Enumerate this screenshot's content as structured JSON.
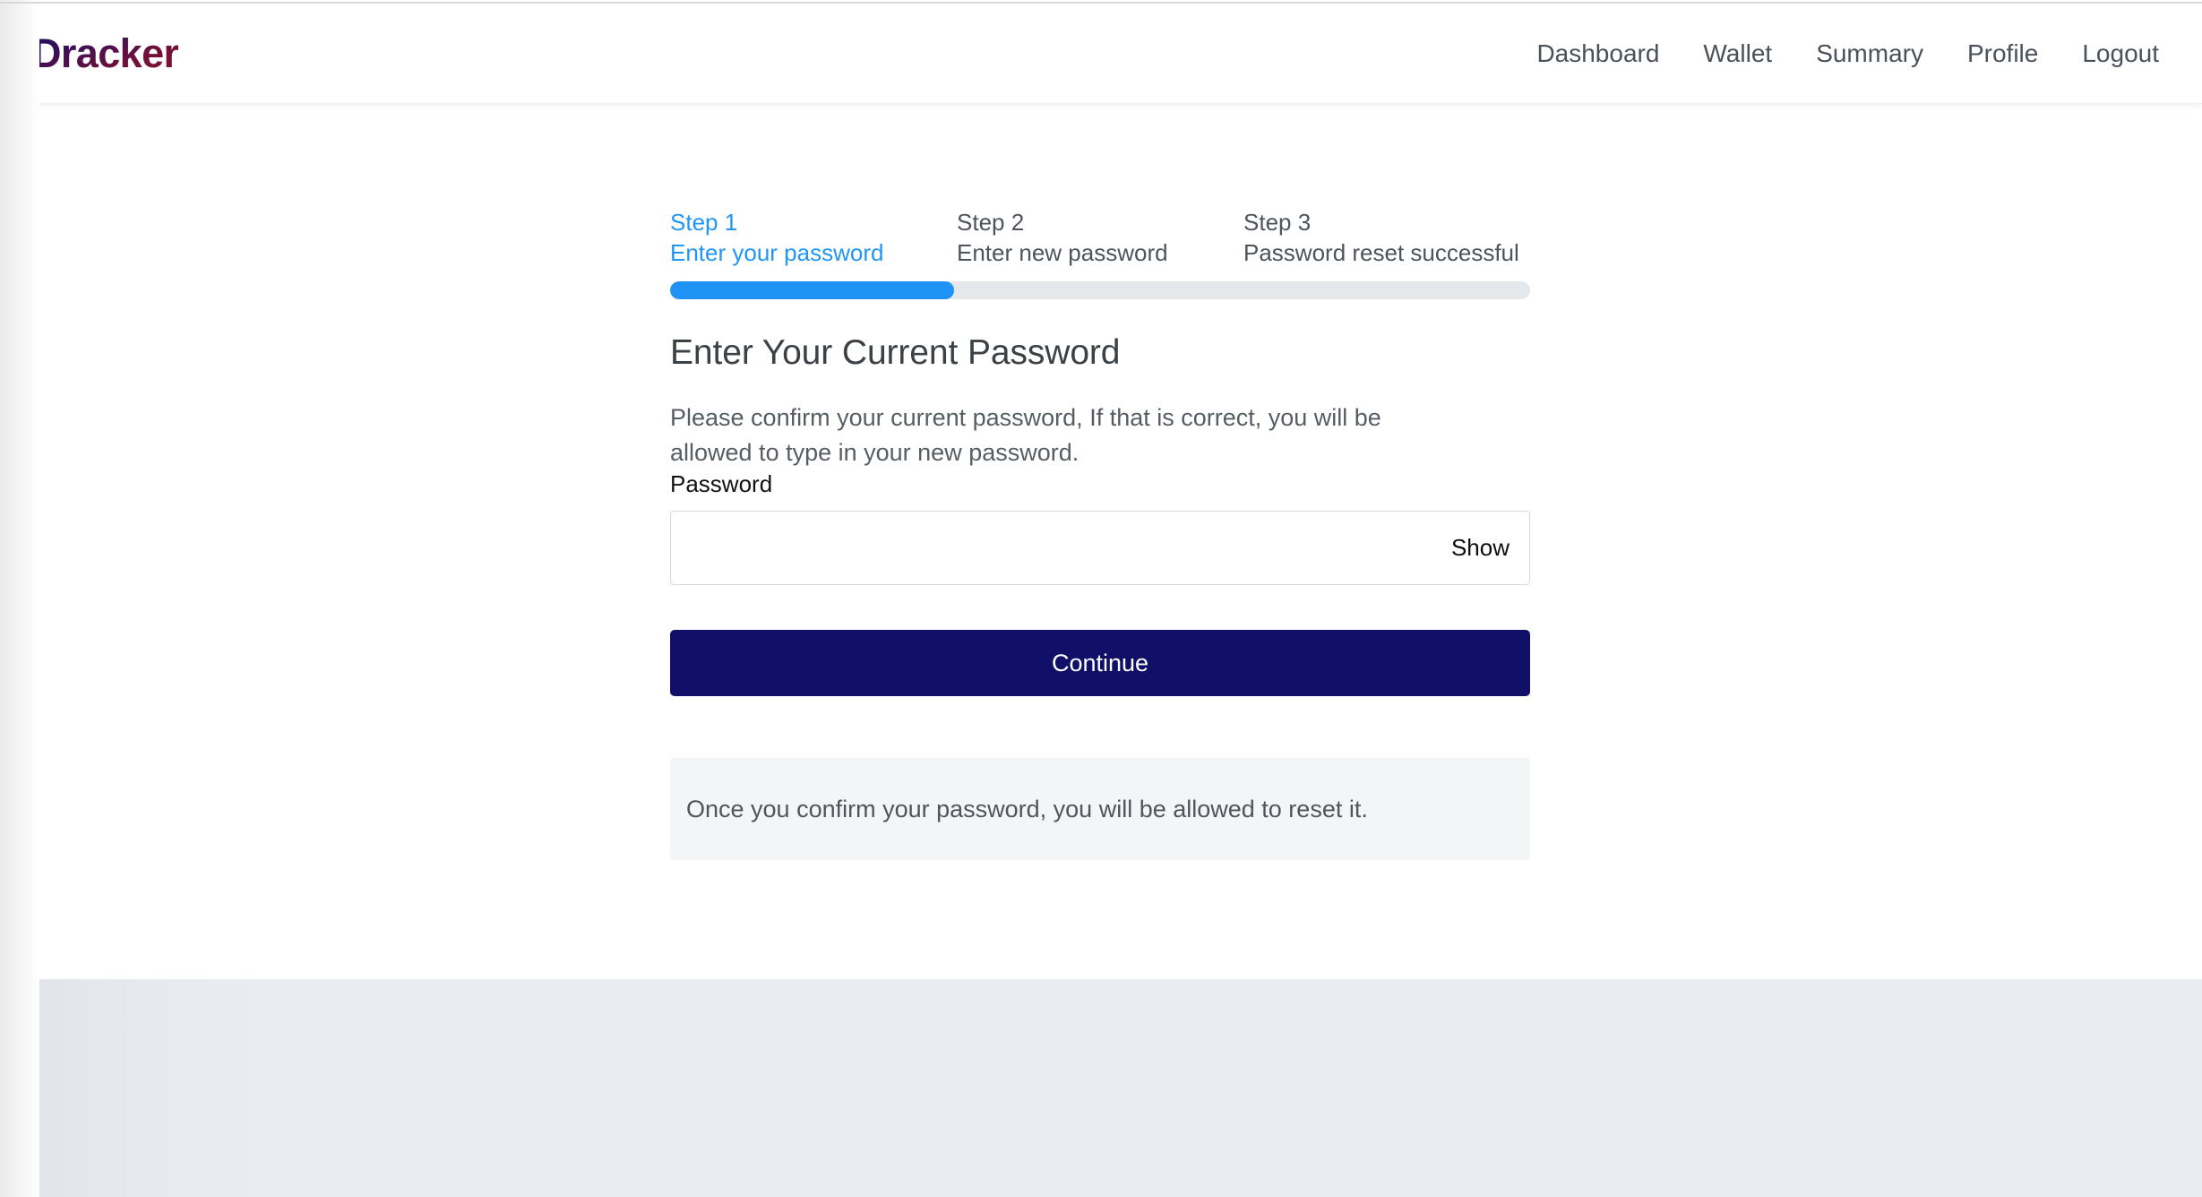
{
  "header": {
    "brand": "Dracker",
    "nav": [
      {
        "label": "Dashboard",
        "name": "nav-link-dashboard"
      },
      {
        "label": "Wallet",
        "name": "nav-link-wallet"
      },
      {
        "label": "Summary",
        "name": "nav-link-summary"
      },
      {
        "label": "Profile",
        "name": "nav-link-profile"
      },
      {
        "label": "Logout",
        "name": "nav-link-logout"
      }
    ]
  },
  "wizard": {
    "steps": [
      {
        "title": "Step 1",
        "subtitle": "Enter your password",
        "active": true
      },
      {
        "title": "Step 2",
        "subtitle": "Enter new password",
        "active": false
      },
      {
        "title": "Step 3",
        "subtitle": "Password reset successful",
        "active": false
      }
    ],
    "progress_percent": 33,
    "active_color": "#2196f3",
    "track_color": "#e5e8ea",
    "fill_color": "#1f93f5"
  },
  "form": {
    "heading": "Enter Your Current Password",
    "description": "Please confirm your current password, If that is correct, you will be allowed to type in your new password.",
    "password_label": "Password",
    "password_value": "",
    "password_placeholder": "",
    "show_toggle_label": "Show",
    "submit_label": "Continue",
    "submit_color": "#111068"
  },
  "info": {
    "message": "Once you confirm your password, you will be allowed to reset it."
  }
}
